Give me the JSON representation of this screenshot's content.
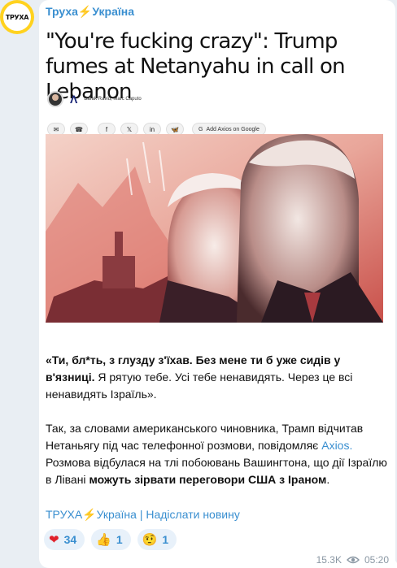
{
  "channel": {
    "avatar_text": "ТРУХА",
    "name": "Труха⚡Україна"
  },
  "preview": {
    "headline": "\"You're fucking crazy\": Trump fumes at Netanyahu in call on Lebanon",
    "axios_mark": "Λ",
    "authors": "Barak Ravid, Marc Caputo",
    "share_icons": [
      "✉",
      "☎",
      "f",
      "𝕏",
      "in",
      "🦋"
    ],
    "google_button": "Add Axios on Google"
  },
  "message": {
    "quote_bold": "«Ти, бл*ть, з глузду з'їхав. Без мене ти б уже сидів у в'язниці.",
    "quote_rest": " Я рятую тебе. Усі тебе ненавидять. Через це всі ненавидять Ізраїль».",
    "p2_start": "Так, за словами американського чиновника, Трамп відчитав Нетаньягу під час телефонної розмови, повідомляє ",
    "p2_link": "Axios.",
    "p2_mid": " Розмова відбулася на тлі побоювань Вашингтона, що дії Ізраїлю в Лівані ",
    "p2_bold": "можуть зірвати переговори США з Іраном",
    "p2_end": ".",
    "footer": "ТРУХА⚡Україна | Надіслати новину"
  },
  "reactions": [
    {
      "emoji": "❤",
      "count": "34"
    },
    {
      "emoji": "👍",
      "count": "1"
    },
    {
      "emoji": "🤨",
      "count": "1"
    }
  ],
  "meta": {
    "views": "15.3K",
    "time": "05:20"
  },
  "colors": {
    "link": "#3a8fd0",
    "avatar_ring": "#ffd21f",
    "heart": "#e0222d"
  }
}
